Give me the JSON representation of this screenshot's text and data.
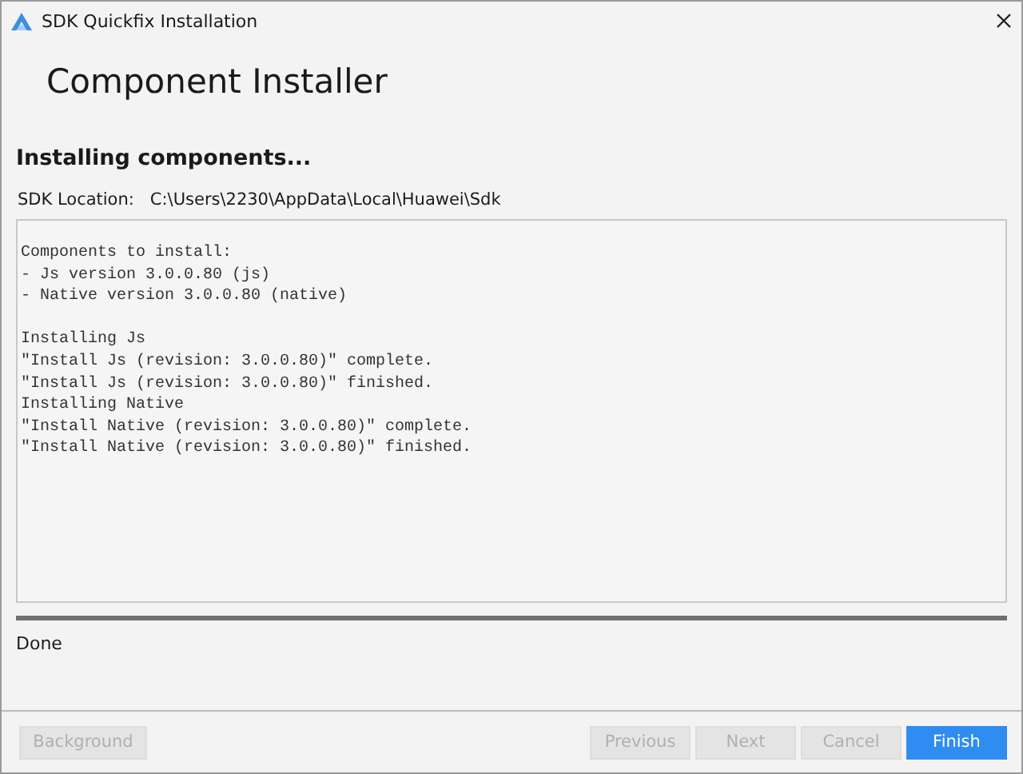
{
  "window": {
    "title": "SDK Quickfix Installation"
  },
  "header": {
    "title": "Component Installer"
  },
  "step": {
    "title": "Installing components...",
    "sdk_location_label": "SDK Location:",
    "sdk_location": "C:\\Users\\2230\\AppData\\Local\\Huawei\\Sdk"
  },
  "log": [
    [
      "Components to install:",
      "- Js version 3.0.0.80 (js)",
      "- Native version 3.0.0.80 (native)"
    ],
    [
      "Installing Js",
      "\"Install Js (revision: 3.0.0.80)\" complete.",
      "\"Install Js (revision: 3.0.0.80)\" finished.",
      "Installing Native",
      "\"Install Native (revision: 3.0.0.80)\" complete.",
      "\"Install Native (revision: 3.0.0.80)\" finished."
    ]
  ],
  "progress": {
    "level": 1
  },
  "status": "Done",
  "buttons": [
    {
      "label": "Background",
      "disabled": true,
      "primary": false
    },
    {
      "label": "Previous",
      "disabled": true,
      "primary": false
    },
    {
      "label": "Next",
      "disabled": true,
      "primary": false
    },
    {
      "label": "Cancel",
      "disabled": true,
      "primary": false
    },
    {
      "label": "Finish",
      "disabled": false,
      "primary": true
    }
  ]
}
